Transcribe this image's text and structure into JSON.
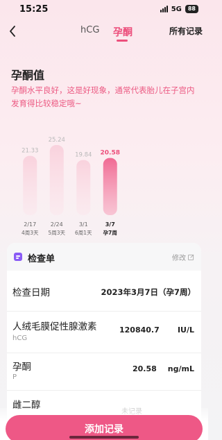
{
  "status_bar": {
    "time": "15:25",
    "network": "5G",
    "battery": "88"
  },
  "nav": {
    "tabs": [
      "hCG",
      "孕酮"
    ],
    "active_tab": "孕酮",
    "records_label": "所有记录"
  },
  "section": {
    "title": "孕酮值",
    "description": "孕酮水平良好，这是好现象，通常代表胎儿在子宫内发育得比较稳定哦~"
  },
  "chart_data": {
    "type": "bar",
    "categories": [
      "2/17",
      "2/24",
      "3/1",
      "3/7"
    ],
    "sublabels": [
      "4周3天",
      "5周3天",
      "6周1天",
      "孕7周"
    ],
    "values": [
      21.33,
      25.24,
      19.84,
      20.58
    ],
    "value_labels": [
      "21.33",
      "25.24",
      "19.84",
      "20.58"
    ],
    "highlight_index": 3,
    "colors": {
      "bar": "#f9d2dd",
      "highlight": "#f06a93",
      "label": "#b9b9b9",
      "highlight_label": "#ec4f7c"
    }
  },
  "card": {
    "title": "检查单",
    "edit_label": "修改",
    "rows": [
      {
        "label": "检查日期",
        "value": "2023年3月7日（孕7周）"
      },
      {
        "label": "人绒毛膜促性腺激素",
        "sub": "hCG",
        "value": "120840.7",
        "unit": "IU/L"
      },
      {
        "label": "孕酮",
        "sub": "P",
        "value": "20.58",
        "unit": "ng/mL"
      },
      {
        "label": "雌二醇",
        "value": "未记录"
      }
    ]
  },
  "footer": {
    "add_label": "添加记录"
  },
  "colors": {
    "accent": "#ec4f7c"
  }
}
